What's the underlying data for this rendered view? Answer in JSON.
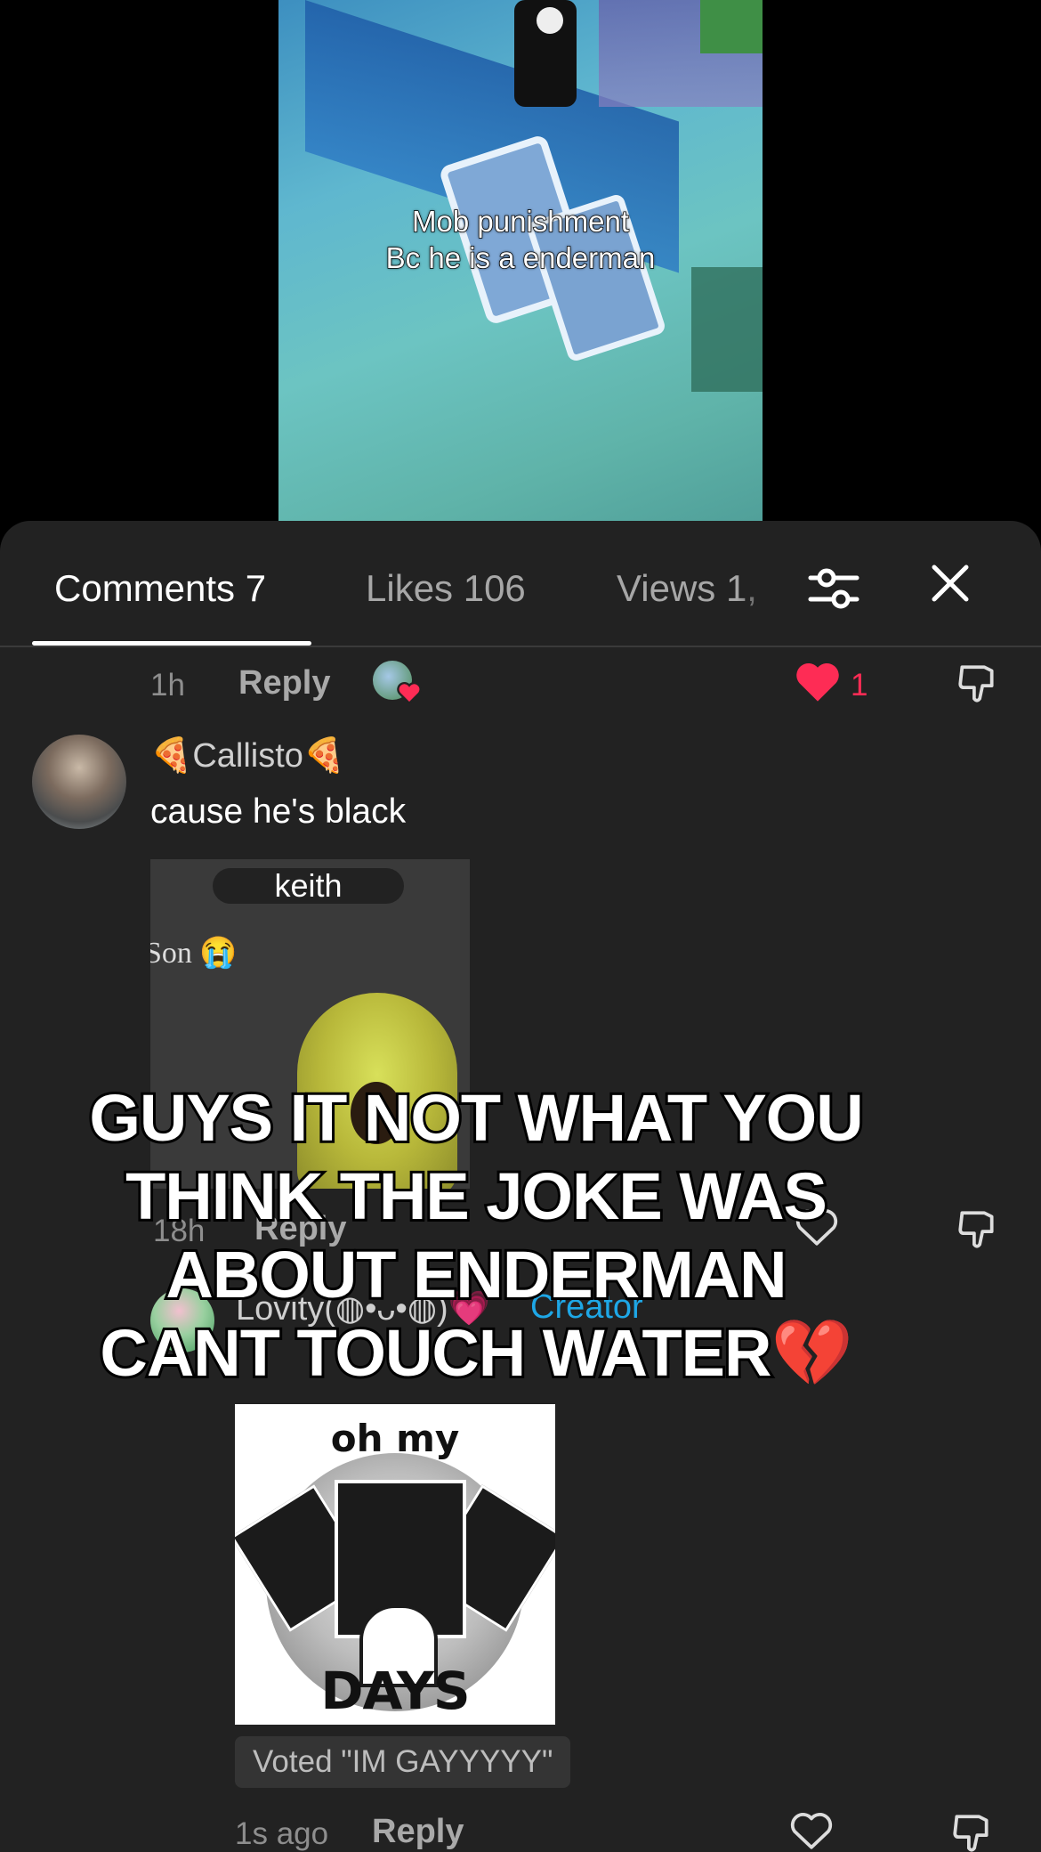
{
  "video": {
    "caption_lines": [
      "Mob punishment",
      "Bc he is a enderman"
    ]
  },
  "tabs": {
    "comments": "Comments 7",
    "likes": "Likes 106",
    "views": "Views 1,"
  },
  "icons": {
    "filter": "filter-sliders-icon",
    "close": "close-icon",
    "heart": "heart-icon",
    "dislike": "thumbs-down-icon"
  },
  "colors": {
    "panel_bg": "#222222",
    "like_active": "#fe2c55",
    "creator_blue": "#1ea7e6"
  },
  "comments": [
    {
      "time": "1h",
      "reply_label": "Reply",
      "like_count": "1"
    },
    {
      "username": "🍕Callisto🍕",
      "text": "cause he's black",
      "meme_label": "keith",
      "meme_side_text": "Son 😭",
      "time": "18h",
      "reply_label": "Reply"
    },
    {
      "username_partial": "Lovity(◍•ᴗ•◍)💗",
      "creator_label": "Creator",
      "meme_top_text": "oh my",
      "meme_bottom_text": "DAYS",
      "vote": "Voted \"IM GAYYYYY\"",
      "time": "1s ago",
      "reply_label": "Reply"
    }
  ],
  "overlay_caption": {
    "lines": [
      "GUYS IT NOT WHAT YOU",
      "THINK THE JOKE WAS",
      "ABOUT ENDERMAN",
      "CANT TOUCH WATER"
    ],
    "emoji": "💔"
  }
}
